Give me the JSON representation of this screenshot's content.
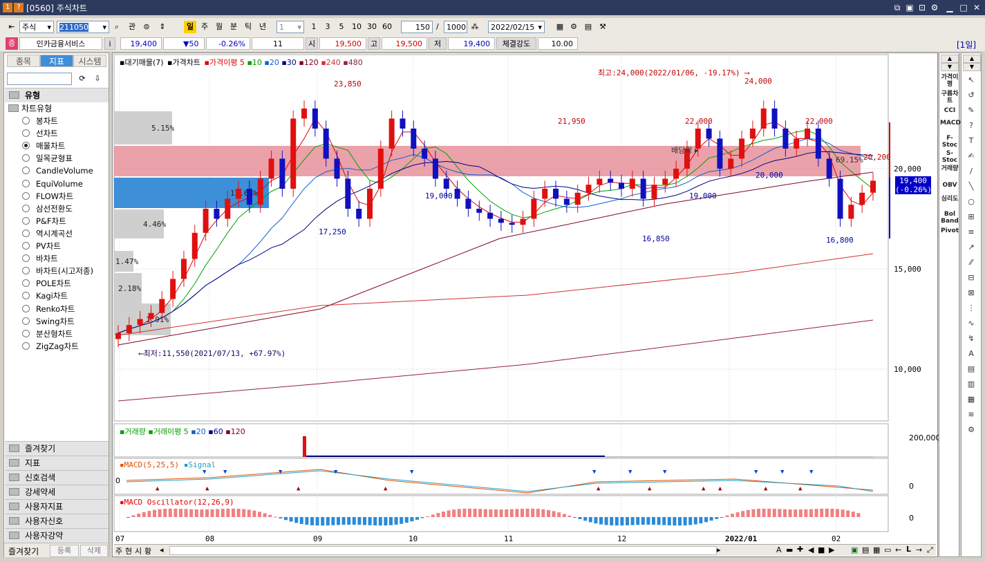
{
  "window": {
    "code": "[0560]",
    "title": "주식차트",
    "badge1": "1",
    "badge2": "?"
  },
  "toolbar": {
    "market": "주식",
    "code": "211050",
    "btn_gwan": "관",
    "periods": [
      "일",
      "주",
      "월",
      "분",
      "틱",
      "년"
    ],
    "period_input": "1",
    "quick": [
      "1",
      "3",
      "5",
      "10",
      "30",
      "60"
    ],
    "count": "150",
    "slash": "/",
    "total": "1000",
    "date": "2022/02/15"
  },
  "info": {
    "badge": "증",
    "name": "인카금융서비스",
    "i": "i",
    "price": "19,400",
    "change": "▼50",
    "rate": "-0.26%",
    "vol": "11",
    "open_label": "시",
    "open": "19,500",
    "high_label": "고",
    "high": "19,500",
    "low_label": "저",
    "low": "19,400",
    "strength_label": "체결강도",
    "strength": "10.00",
    "period_tag": "[1일]"
  },
  "leftpanel": {
    "tabs": [
      "종목",
      "지표",
      "시스템"
    ],
    "section_title": "유형",
    "tree_root": "차트유형",
    "chart_types": [
      "봉차트",
      "선차트",
      "매물차트",
      "일목균형표",
      "CandleVolume",
      "EquiVolume",
      "FLOW차트",
      "삼선전환도",
      "P&F차트",
      "역시계곡선",
      "PV차트",
      "바차트",
      "바차트(시고저종)",
      "POLE차트",
      "Kagi차트",
      "Renko차트",
      "Swing차트",
      "분산형차트",
      "ZigZag차트"
    ],
    "selected_index": 2,
    "sections": [
      "즐겨찾기",
      "지표",
      "신호검색",
      "강세약세",
      "사용자지표",
      "사용자신호",
      "사용자강약"
    ],
    "bottom_tabs": [
      "즐겨찾기",
      "등록",
      "삭제"
    ]
  },
  "chart": {
    "legend": {
      "vol_profile": "대기매물(7)",
      "price": "가격차트",
      "ma_label": "가격이평",
      "ma": [
        "5",
        "10",
        "20",
        "30",
        "120",
        "240",
        "480"
      ]
    },
    "annotations": {
      "high": "최고:24,000(2022/01/06, -19.17%)",
      "low": "최저:11,550(2021/07/13, +67.97%)",
      "ex_div": "배당락",
      "pct_right": "69.15%",
      "price_tag": "19,400",
      "price_tag2": "(-0.26%)"
    },
    "peaks": [
      "23,850",
      "21,950",
      "22,000",
      "24,000",
      "22,000",
      "20,200"
    ],
    "troughs": [
      "19,000",
      "17,250",
      "16,850",
      "19,000",
      "20,000",
      "16,800"
    ],
    "vol_profile_pcts": [
      "5.15%",
      "12.68%",
      "4.46%",
      "1.47%",
      "2.18%",
      "1.91%"
    ],
    "y_ticks": [
      "20,000",
      "15,000",
      "10,000"
    ],
    "x_ticks": [
      "07",
      "08",
      "09",
      "10",
      "11",
      "12",
      "2022/01",
      "02"
    ],
    "volume_legend": {
      "label": "거래량",
      "ma_label": "거래이평",
      "ma": [
        "5",
        "20",
        "60",
        "120"
      ],
      "tick": "200,000"
    },
    "macd_legend": {
      "label": "MACD(5,25,5)",
      "signal": "Signal",
      "tick": "0",
      "left_tick": "0"
    },
    "osc_legend": {
      "label": "MACD Oscillator(12,26,9)",
      "tick": "0"
    },
    "bottom_tabs": [
      "주",
      "현",
      "시",
      "황"
    ]
  },
  "right_indicators": [
    "가격이평",
    "구름차트",
    "CCI",
    "MACD",
    "F-Stoc",
    "S-Stoc",
    "거래량",
    "OBV",
    "심리도",
    "Bol Band",
    "Pivot"
  ],
  "colors": {
    "up": "#e01010",
    "down": "#1010c0",
    "ma5": "#e00000",
    "ma10": "#00a000",
    "ma20": "#1060d0",
    "ma30": "#000080",
    "ma120": "#800020",
    "ma240": "#d03030",
    "ma480": "#902040"
  }
}
